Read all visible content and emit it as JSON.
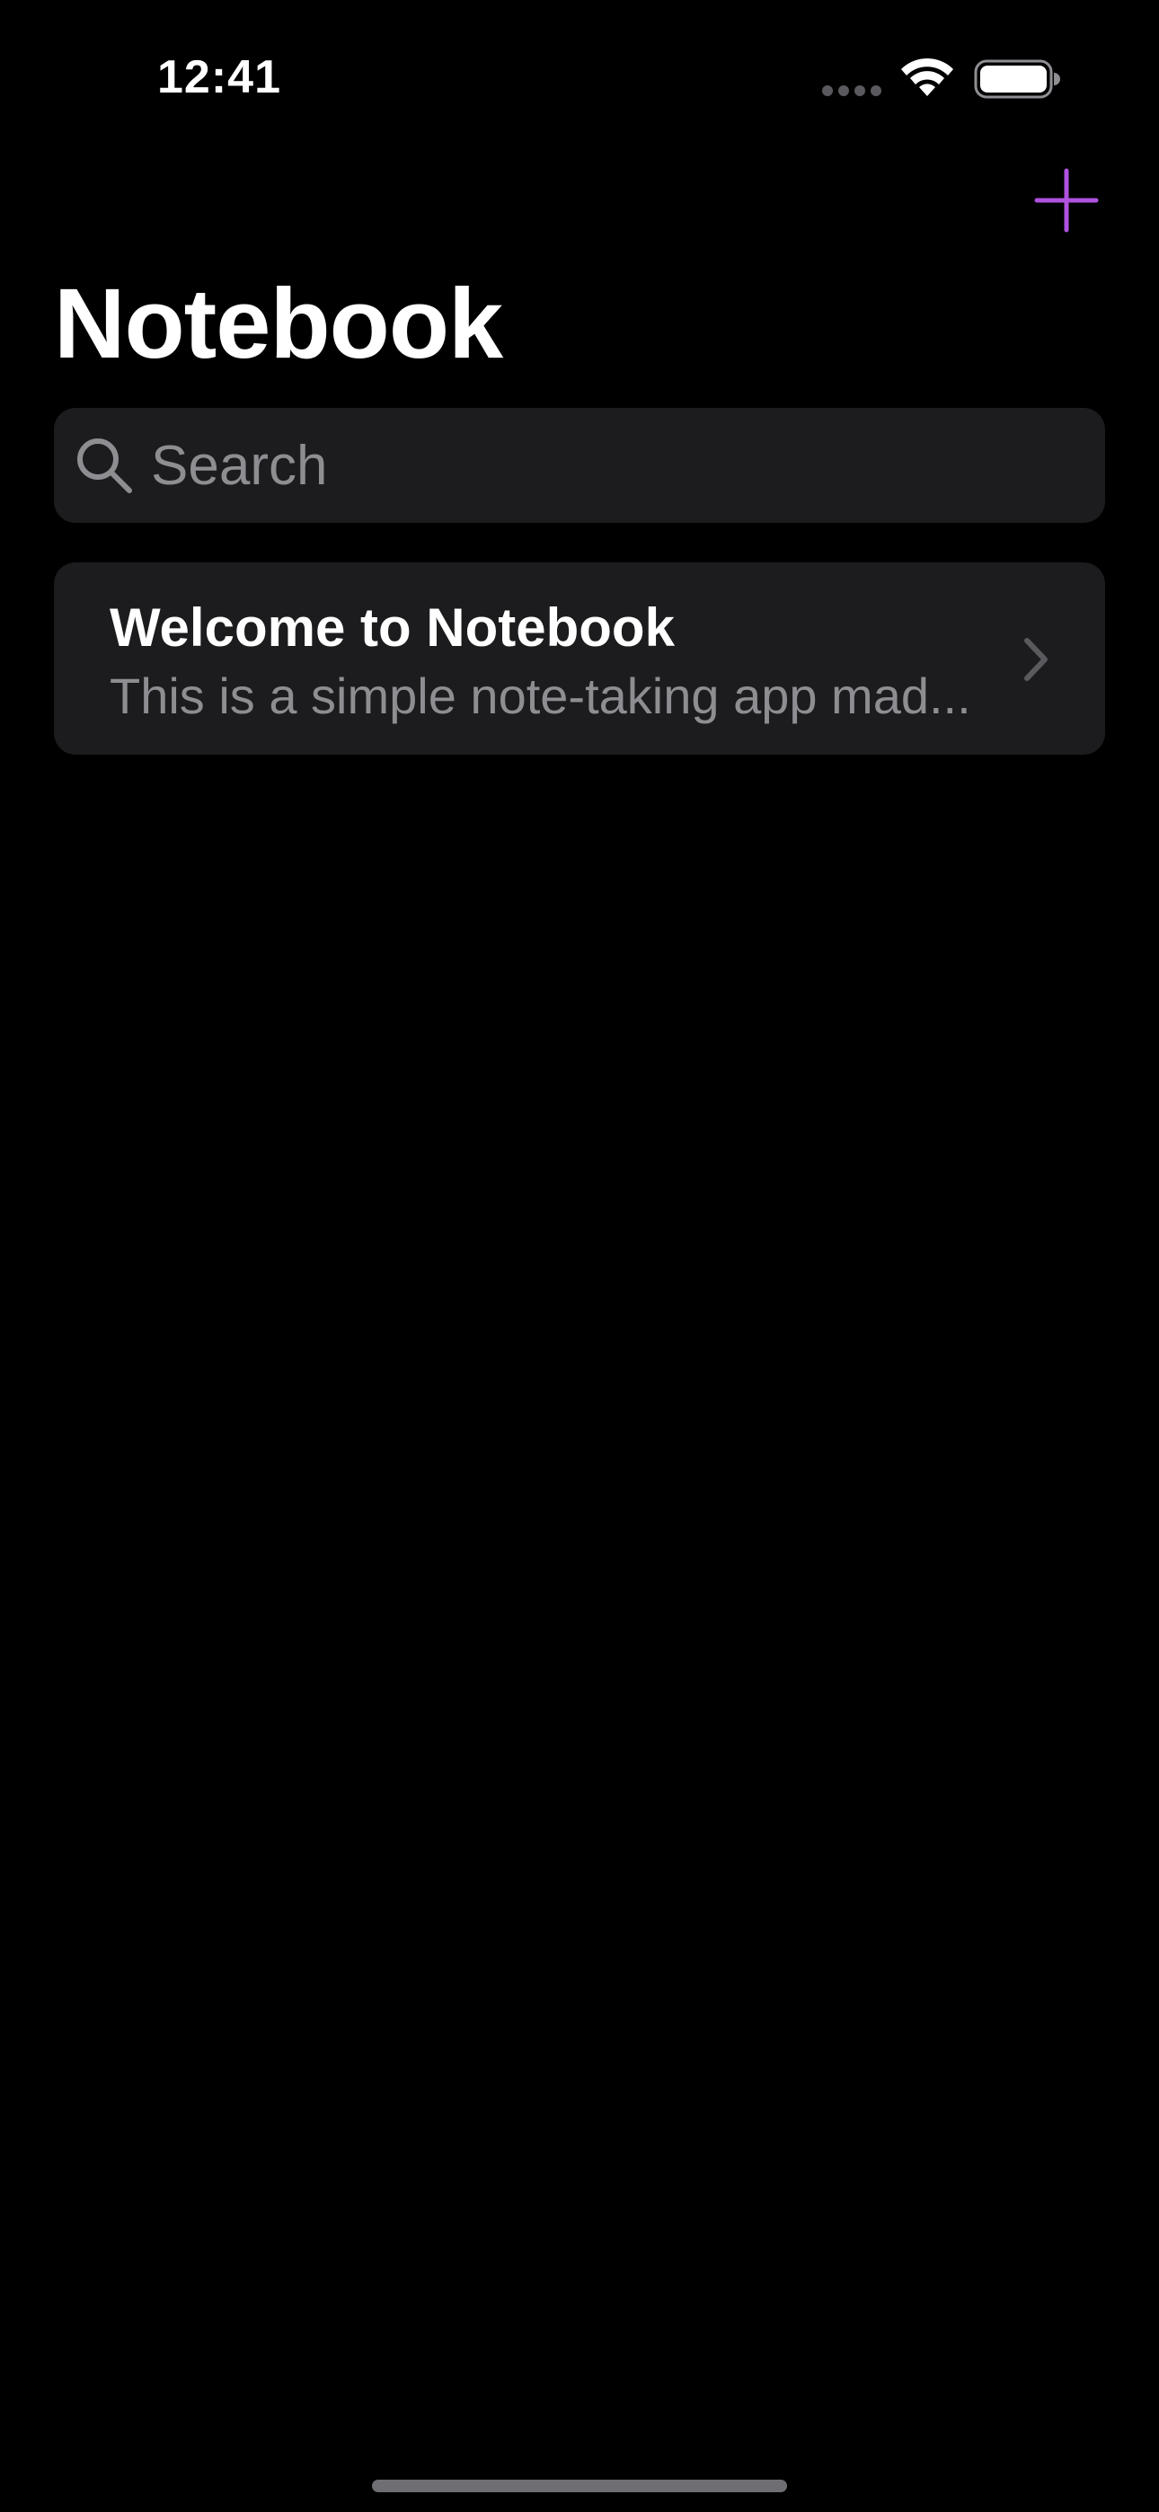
{
  "status_bar": {
    "time": "12:41"
  },
  "header": {
    "title": "Notebook",
    "add_icon": "plus-icon",
    "accent_color": "#af52de"
  },
  "search": {
    "placeholder": "Search",
    "value": "",
    "icon": "search-icon"
  },
  "notes": [
    {
      "title": "Welcome to Notebook",
      "preview": "This is a simple note-taking app mad..."
    }
  ],
  "colors": {
    "background": "#000000",
    "card": "#1c1c1e",
    "secondary_text": "#8d8d92"
  }
}
